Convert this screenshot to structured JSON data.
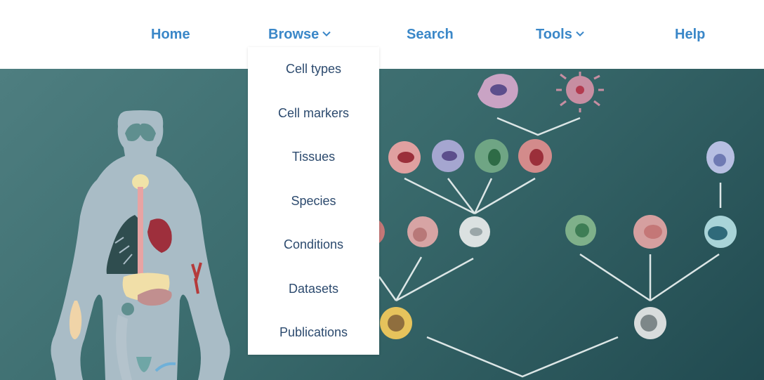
{
  "nav": {
    "home": "Home",
    "browse": "Browse",
    "search": "Search",
    "tools": "Tools",
    "help": "Help"
  },
  "browse_menu": {
    "items": [
      {
        "label": "Cell types"
      },
      {
        "label": "Cell markers"
      },
      {
        "label": "Tissues"
      },
      {
        "label": "Species"
      },
      {
        "label": "Conditions"
      },
      {
        "label": "Datasets"
      },
      {
        "label": "Publications"
      }
    ]
  },
  "icons": {
    "browse": "chevron-down-icon",
    "tools": "chevron-down-icon"
  },
  "colors": {
    "nav_link": "#3a87c8",
    "menu_text": "#2c4a6e",
    "hero_dark": "#214a50",
    "hero_light": "#4e7e80"
  }
}
